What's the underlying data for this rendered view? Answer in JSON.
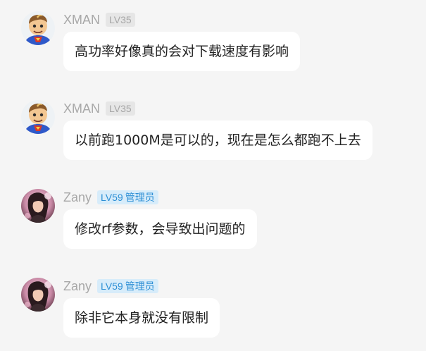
{
  "messages": [
    {
      "user": "XMAN",
      "level": "LV35",
      "role": "",
      "text": "高功率好像真的会对下载速度有影响",
      "avatar_icon": "superman-avatar-icon"
    },
    {
      "user": "XMAN",
      "level": "LV35",
      "role": "",
      "text": "以前跑1000M是可以的，现在是怎么都跑不上去",
      "avatar_icon": "superman-avatar-icon"
    },
    {
      "user": "Zany",
      "level": "LV59",
      "role": "管理员",
      "text": "修改rf参数，会导致出问题的",
      "avatar_icon": "pink-portrait-avatar-icon"
    },
    {
      "user": "Zany",
      "level": "LV59",
      "role": "管理员",
      "text": "除非它本身就没有限制",
      "avatar_icon": "pink-portrait-avatar-icon"
    }
  ],
  "colors": {
    "background": "#f5f5f5",
    "bubble": "#ffffff",
    "username": "#a8a8a8",
    "level_badge_bg": "#e6e6e6",
    "level_badge_text": "#a6a6a6",
    "admin_badge_bg": "#d7ecfa",
    "admin_badge_text": "#2d8fd5"
  }
}
